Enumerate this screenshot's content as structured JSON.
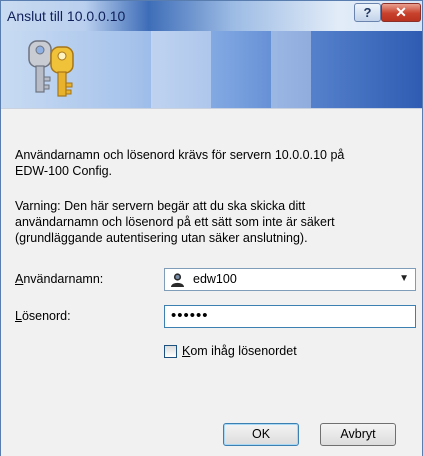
{
  "window": {
    "title": "Anslut till 10.0.0.10",
    "help_label": "?",
    "close_label": "✕"
  },
  "message": {
    "line1": "Användarnamn och lösenord krävs för servern 10.0.0.10 på",
    "line2": "EDW-100 Config.",
    "warning1": "Varning: Den här servern begär att du ska skicka ditt",
    "warning2": "användarnamn och lösenord på ett sätt som inte är säkert",
    "warning3": "(grundläggande autentisering utan säker anslutning)."
  },
  "form": {
    "username_label_first": "A",
    "username_label_rest": "nvändarnamn:",
    "username_value": "edw100",
    "password_label_first": "L",
    "password_label_rest": "ösenord:",
    "password_value": "••••••",
    "remember_first": "K",
    "remember_rest": "om ihåg lösenordet"
  },
  "buttons": {
    "ok_label": "OK",
    "cancel_label": "Avbryt"
  },
  "icons": {
    "banner": "keys-icon",
    "user": "user-icon",
    "dropdown": "chevron-down-icon"
  }
}
